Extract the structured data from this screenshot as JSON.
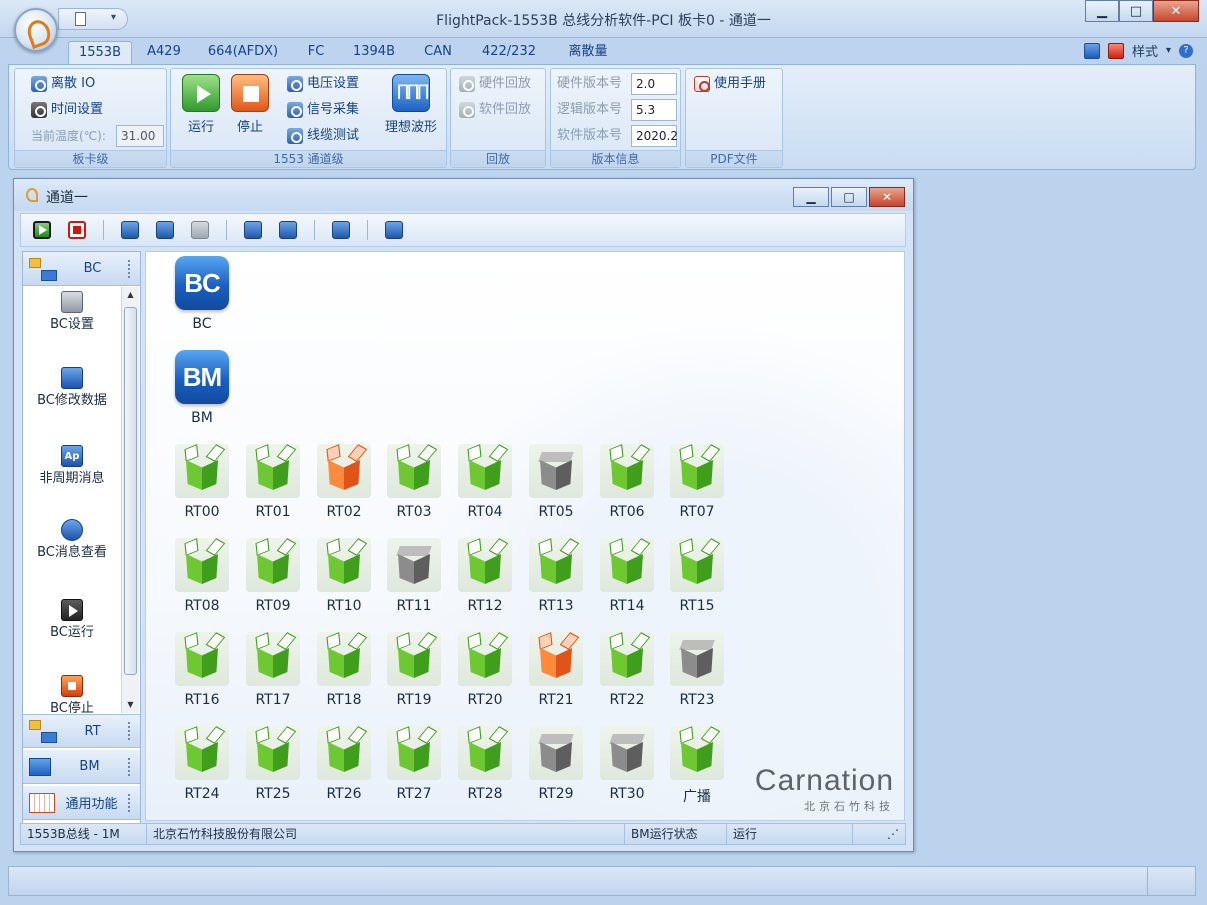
{
  "app": {
    "title": "FlightPack-1553B 总线分析软件-PCI  板卡0 - 通道一"
  },
  "window_controls": {
    "minimize": "▁",
    "maximize": "□",
    "close": "✕"
  },
  "ribbon_tabs": [
    {
      "label": "1553B"
    },
    {
      "label": "A429"
    },
    {
      "label": "664(AFDX)"
    },
    {
      "label": "FC"
    },
    {
      "label": "1394B"
    },
    {
      "label": "CAN"
    },
    {
      "label": "422/232"
    },
    {
      "label": "离散量"
    }
  ],
  "ribbon_right": {
    "style_label": "样式",
    "dropdown": "▾",
    "help": "?"
  },
  "groups": {
    "card": {
      "caption": "板卡级",
      "discrete_io": "离散 IO",
      "time_settings": "时间设置",
      "temp_label": "当前温度(℃):",
      "temp_value": "31.00"
    },
    "channel": {
      "caption": "1553 通道级",
      "run": "运行",
      "stop": "停止",
      "voltage": "电压设置",
      "signal": "信号采集",
      "cable": "线缆测试",
      "wave": "理想波形"
    },
    "replay": {
      "caption": "回放",
      "hw_replay": "硬件回放",
      "sw_replay": "软件回放"
    },
    "version": {
      "caption": "版本信息",
      "hw_label": "硬件版本号",
      "hw_value": "2.0",
      "logic_label": "逻辑版本号",
      "logic_value": "5.3",
      "sw_label": "软件版本号",
      "sw_value": "2020.2"
    },
    "pdf": {
      "caption": "PDF文件",
      "manual": "使用手册"
    }
  },
  "child_window": {
    "title": "通道一"
  },
  "nav": {
    "bc_header": "BC",
    "items": [
      {
        "label": "BC设置",
        "icon": "gear-icon"
      },
      {
        "label": "BC修改数据",
        "icon": "edit-icon"
      },
      {
        "label": "非周期消息",
        "icon": "ap-icon"
      },
      {
        "label": "BC消息查看",
        "icon": "view-icon"
      },
      {
        "label": "BC运行",
        "icon": "play-icon"
      },
      {
        "label": "BC停止",
        "icon": "stop-icon"
      }
    ],
    "rt_header": "RT",
    "bm_header": "BM",
    "common_header": "通用功能"
  },
  "devices": {
    "bc": {
      "label": "BC",
      "icon_text": "BC"
    },
    "bm": {
      "label": "BM",
      "icon_text": "BM"
    },
    "rts": [
      {
        "label": "RT00",
        "state": "active"
      },
      {
        "label": "RT01",
        "state": "active"
      },
      {
        "label": "RT02",
        "state": "warning"
      },
      {
        "label": "RT03",
        "state": "active"
      },
      {
        "label": "RT04",
        "state": "active"
      },
      {
        "label": "RT05",
        "state": "inactive"
      },
      {
        "label": "RT06",
        "state": "active"
      },
      {
        "label": "RT07",
        "state": "active"
      },
      {
        "label": "RT08",
        "state": "active"
      },
      {
        "label": "RT09",
        "state": "active"
      },
      {
        "label": "RT10",
        "state": "active"
      },
      {
        "label": "RT11",
        "state": "inactive"
      },
      {
        "label": "RT12",
        "state": "active"
      },
      {
        "label": "RT13",
        "state": "active"
      },
      {
        "label": "RT14",
        "state": "active"
      },
      {
        "label": "RT15",
        "state": "active"
      },
      {
        "label": "RT16",
        "state": "active"
      },
      {
        "label": "RT17",
        "state": "active"
      },
      {
        "label": "RT18",
        "state": "active"
      },
      {
        "label": "RT19",
        "state": "active"
      },
      {
        "label": "RT20",
        "state": "active"
      },
      {
        "label": "RT21",
        "state": "warning"
      },
      {
        "label": "RT22",
        "state": "active"
      },
      {
        "label": "RT23",
        "state": "inactive"
      },
      {
        "label": "RT24",
        "state": "active"
      },
      {
        "label": "RT25",
        "state": "active"
      },
      {
        "label": "RT26",
        "state": "active"
      },
      {
        "label": "RT27",
        "state": "active"
      },
      {
        "label": "RT28",
        "state": "active"
      },
      {
        "label": "RT29",
        "state": "inactive"
      },
      {
        "label": "RT30",
        "state": "inactive"
      },
      {
        "label": "广播",
        "state": "active"
      }
    ]
  },
  "watermark": {
    "brand": "Carnation",
    "sub": "北京石竹科技"
  },
  "status": {
    "bus": "1553B总线 - 1M",
    "company": "北京石竹科技股份有限公司",
    "bm_state_label": "BM运行状态",
    "bm_state_value": "运行"
  },
  "colors": {
    "active": "#6ec832",
    "warning": "#ff8a3d",
    "inactive": "#8c8c8c",
    "accent": "#15428b"
  }
}
